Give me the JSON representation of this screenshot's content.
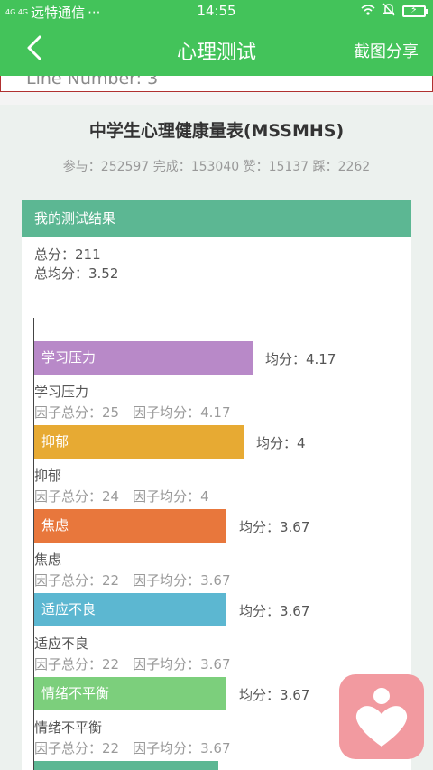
{
  "status_bar": {
    "signal": "4G 4G",
    "carrier": "远特通信",
    "dots": "···",
    "time": "14:55"
  },
  "nav": {
    "title": "心理测试",
    "share_label": "截图分享"
  },
  "debug_line": "Line Number: 3",
  "test": {
    "title": "中学生心理健康量表(MSSMHS)",
    "stats_text": "参与：252597 完成：153040 赞：15137 踩：2262"
  },
  "result": {
    "header": "我的测试结果",
    "total": "总分：211",
    "total_avg": "总均分：3.52"
  },
  "chart_data": {
    "type": "bar",
    "orientation": "horizontal",
    "categories": [
      "学习压力",
      "抑郁",
      "焦虑",
      "适应不良",
      "情绪不平衡"
    ],
    "values": [
      4.17,
      4,
      3.67,
      3.67,
      3.67
    ],
    "colors": [
      "#b889c8",
      "#e7aa33",
      "#e8773c",
      "#5cb7d1",
      "#7ccf7c"
    ],
    "bar_labels": [
      "学习压力",
      "抑郁",
      "焦虑",
      "适应不良",
      "情绪不平衡"
    ],
    "avg_labels": [
      "均分：4.17",
      "均分：4",
      "均分：3.67",
      "均分：3.67",
      "均分：3.67"
    ],
    "details": [
      "因子总分：25　因子均分：4.17",
      "因子总分：24　因子均分：4",
      "因子总分：22　因子均分：3.67",
      "因子总分：22　因子均分：3.67",
      "因子总分：22　因子均分：3.67"
    ],
    "next_bar_color": "#5cb793"
  },
  "icons": {
    "back": "chevron-left-icon",
    "fab": "heart-person-icon",
    "wifi": "wifi-icon",
    "bell": "bell-muted-icon",
    "battery": "battery-charging-icon"
  }
}
